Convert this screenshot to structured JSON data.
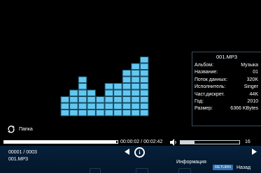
{
  "visualizer": {
    "columns": [
      3,
      4,
      6,
      4,
      3,
      5,
      5,
      7,
      8,
      9
    ],
    "color": "#63c8f0"
  },
  "info_panel": {
    "filename": "001.MP3",
    "rows": [
      {
        "label": "Альбом:",
        "value": "Музыка"
      },
      {
        "label": "Название:",
        "value": "01"
      },
      {
        "label": "Поток данных:",
        "value": "320K"
      },
      {
        "label": "Исполнитель:",
        "value": "Singer"
      },
      {
        "label": "Част.дискрет.",
        "value": "44K"
      },
      {
        "label": "Год:",
        "value": "2010"
      },
      {
        "label": "Размер:",
        "value": "6366 KBytes"
      }
    ]
  },
  "folder": {
    "label": "Папка",
    "icon": "repeat-icon"
  },
  "playback": {
    "progress_fraction": 0.99,
    "time": "00:00:02 / 00:02:42",
    "volume_fraction": 0.24,
    "volume": "16"
  },
  "bottom": {
    "track_counter": "00001 / 0003",
    "filename": "001.MP3",
    "info_label": "Информация",
    "return_key": "RETURN",
    "back_label": "Назад"
  }
}
